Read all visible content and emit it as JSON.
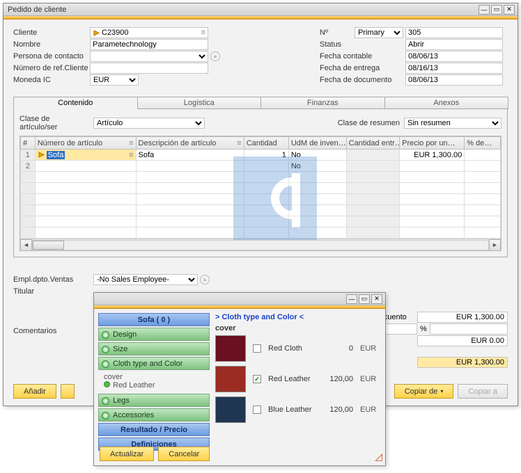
{
  "main": {
    "title": "Pedido de cliente",
    "left": {
      "cliente_label": "Cliente",
      "cliente_value": "C23900",
      "nombre_label": "Nombre",
      "nombre_value": "Parametechnology",
      "persona_label": "Persona de contacto",
      "persona_value": "",
      "numref_label": "Número de ref.Cliente",
      "numref_value": "",
      "moneda_label": "Moneda IC",
      "moneda_value": "EUR"
    },
    "right": {
      "no_label": "Nº",
      "no_select": "Primary",
      "no_value": "305",
      "status_label": "Status",
      "status_value": "Abrir",
      "fecha_cont_label": "Fecha contable",
      "fecha_cont_value": "08/06/13",
      "fecha_entr_label": "Fecha de entrega",
      "fecha_entr_value": "08/16/13",
      "fecha_doc_label": "Fecha de documento",
      "fecha_doc_value": "08/06/13"
    },
    "tabs": [
      "Contenido",
      "Logística",
      "Finanzas",
      "Anexos"
    ],
    "tab_content": {
      "clase_art_label": "Clase de artículo/ser",
      "clase_art_value": "Artículo",
      "clase_res_label": "Clase de resumen",
      "clase_res_value": "Sin resumen",
      "columns": [
        "#",
        "Número de artículo",
        "Descripción de artículo",
        "Cantidad",
        "UdM de inven…",
        "Cantidad entr…",
        "Precio por un…",
        "% de…"
      ],
      "rows": [
        {
          "n": "1",
          "item": "Sofa",
          "desc": "Sofa",
          "qty": "1",
          "uom": "No",
          "delivered": "",
          "price": "EUR 1,300.00",
          "disc": ""
        },
        {
          "n": "2",
          "item": "",
          "desc": "",
          "qty": "",
          "uom": "No",
          "delivered": "",
          "price": "",
          "disc": ""
        }
      ]
    },
    "bottom": {
      "empl_label": "Empl.dpto.Ventas",
      "empl_value": "-No Sales Employee-",
      "titular_label": "Titular",
      "titular_value": "",
      "comentarios_label": "Comentarios"
    },
    "totals": {
      "total_antes_label": "Total antes del descuento",
      "total_antes_value": "EUR 1,300.00",
      "pct_label": "%",
      "eur_zero": "EUR 0.00",
      "total_final": "EUR 1,300.00"
    },
    "buttons": {
      "anadir": "Añadir",
      "copiar_de": "Copiar de",
      "copiar_a": "Copiar a"
    }
  },
  "cfg": {
    "heading": "Sofa  ( 0 )",
    "left_items": [
      "Design",
      "Size",
      "Cloth type and Color"
    ],
    "selected_sub_label": "cover",
    "selected_sub_value": "Red Leather",
    "left_items2": [
      "Legs",
      "Accessories"
    ],
    "result_label": "Resultado / Precio",
    "defs_label": "Definiciones",
    "right_title": "> Cloth type and Color <",
    "cover_label": "cover",
    "swatches": [
      {
        "name": "Red Cloth",
        "price": "0",
        "cur": "EUR",
        "color": "#6a1020",
        "checked": false
      },
      {
        "name": "Red Leather",
        "price": "120,00",
        "cur": "EUR",
        "color": "#9a2c24",
        "checked": true
      },
      {
        "name": "Blue Leather",
        "price": "120,00",
        "cur": "EUR",
        "color": "#1f3652",
        "checked": false
      }
    ],
    "btn_update": "Actualizar",
    "btn_cancel": "Cancelar"
  }
}
